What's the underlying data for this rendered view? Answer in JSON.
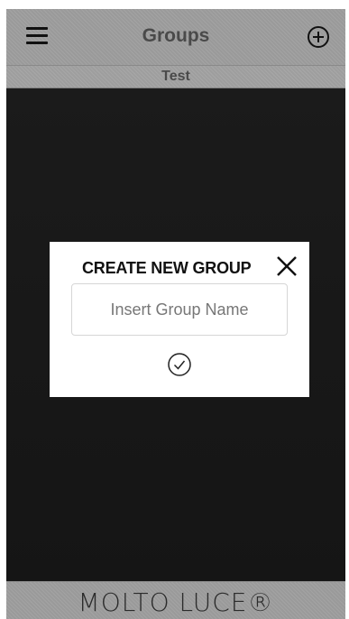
{
  "header": {
    "title": "Groups",
    "subtitle": "Test",
    "menu_icon": "hamburger-menu-icon",
    "add_icon": "add-circle-icon"
  },
  "modal": {
    "title": "CREATE NEW GROUP",
    "input_placeholder": "Insert Group Name",
    "close_icon": "close-icon",
    "confirm_icon": "check-circle-icon"
  },
  "footer": {
    "logo_text": "MOLTO LUCE®"
  },
  "colors": {
    "background": "#1a1a1a",
    "bar": "#9e9e9e",
    "modal": "#ffffff",
    "title_text": "#4a4a4a"
  }
}
